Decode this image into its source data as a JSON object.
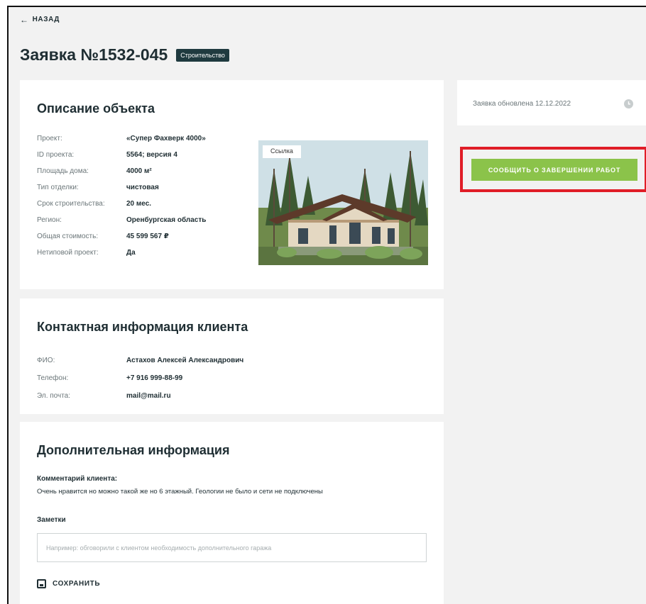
{
  "back_label": "НАЗАД",
  "title": "Заявка №1532-045",
  "tag": "Строительство",
  "object": {
    "heading": "Описание объекта",
    "rows": [
      {
        "label": "Проект:",
        "value": "«Супер Фахверк 4000»"
      },
      {
        "label": "ID проекта:",
        "value": "5564; версия 4"
      },
      {
        "label": "Площадь дома:",
        "value": "4000 м²"
      },
      {
        "label": "Тип отделки:",
        "value": "чистовая"
      },
      {
        "label": "Срок строительства:",
        "value": "20 мес."
      },
      {
        "label": "Регион:",
        "value": "Оренбургская область"
      },
      {
        "label": "Общая стоимость:",
        "value": "45 599 567 ₽"
      },
      {
        "label": "Нетиповой проект:",
        "value": "Да"
      }
    ],
    "photo_link": "Ссылка"
  },
  "contact": {
    "heading": "Контактная информация клиента",
    "rows": [
      {
        "label": "ФИО:",
        "value": "Астахов Алексей Александрович"
      },
      {
        "label": "Телефон:",
        "value": "+7 916 999-88-99"
      },
      {
        "label": "Эл. почта:",
        "value": "mail@mail.ru"
      }
    ]
  },
  "additional": {
    "heading": "Дополнительная информация",
    "comment_label": "Комментарий клиента:",
    "comment_text": "Очень нравится но можно такой же но 6 этажный. Геологии не было и сети не подключены",
    "notes_label": "Заметки",
    "notes_placeholder": "Например: обговорили с клиентом необходимость дополнительного гаража",
    "notes_value": "",
    "save_label": "СОХРАНИТЬ"
  },
  "side": {
    "updated_text": "Заявка обновлена 12.12.2022",
    "report_button": "СООБЩИТЬ О ЗАВЕРШЕНИИ РАБОТ"
  },
  "colors": {
    "accent_green": "#8bc34a",
    "highlight_red": "#e01d27",
    "tag_bg": "#1f3a3f",
    "text_dark": "#1f2e33"
  }
}
